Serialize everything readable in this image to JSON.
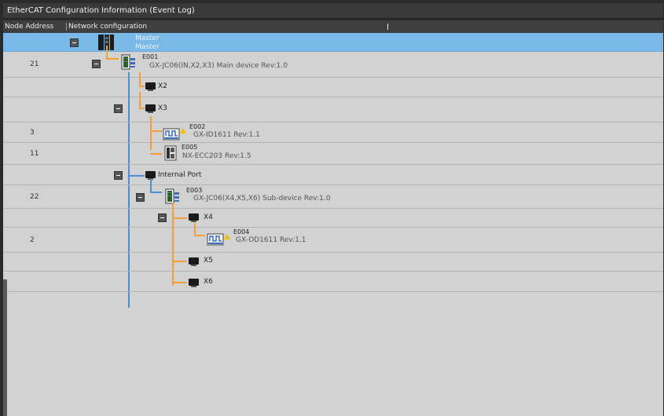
{
  "window": {
    "title": "EtherCAT Configuration Information (Event Log)"
  },
  "columns": {
    "node_address": "Node Address",
    "network_configuration": "Network configuration"
  },
  "master": {
    "name": "Master",
    "sub": "Master"
  },
  "rows": {
    "e001": {
      "address": "21",
      "id": "E001",
      "desc": "GX-JC06(IN,X2,X3) Main device Rev:1.0"
    },
    "x2": {
      "label": "X2"
    },
    "x3": {
      "label": "X3"
    },
    "e002": {
      "address": "3",
      "id": "E002",
      "desc": "GX-ID1611 Rev:1.1"
    },
    "e005": {
      "address": "11",
      "id": "E005",
      "desc": "NX-ECC203 Rev:1.5"
    },
    "internal": {
      "label": "Internal Port"
    },
    "e003": {
      "address": "22",
      "id": "E003",
      "desc": "GX-JC06(X4,X5,X6) Sub-device Rev:1.0"
    },
    "x4": {
      "label": "X4"
    },
    "e004": {
      "address": "2",
      "id": "E004",
      "desc": "GX-OD1611 Rev:1.1"
    },
    "x5": {
      "label": "X5"
    },
    "x6": {
      "label": "X6"
    }
  },
  "colors": {
    "selection": "#7ab8e8",
    "link_orange": "#f5a030",
    "link_blue": "#4a90d9",
    "warning": "#f2c200"
  },
  "icons": [
    "collapse-icon",
    "master-controller-icon",
    "junction-slave-icon",
    "port-icon",
    "io-module-icon",
    "coupler-icon",
    "warning-icon"
  ]
}
